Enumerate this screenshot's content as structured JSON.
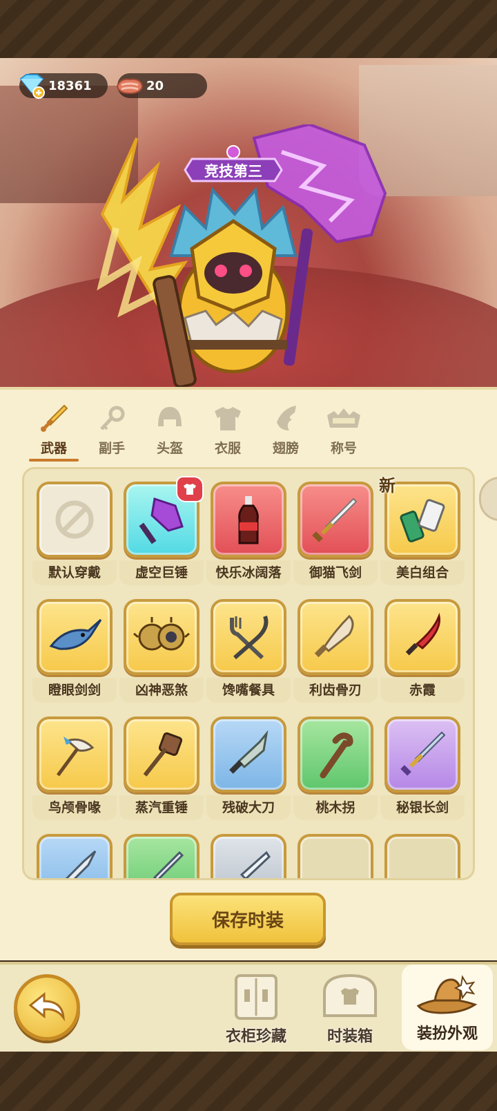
{
  "currency": {
    "gems": "18361",
    "meat": "20"
  },
  "character": {
    "title_banner": "竞技第三"
  },
  "tabs": [
    {
      "label": "武器",
      "icon": "sword-icon",
      "active": true
    },
    {
      "label": "副手",
      "icon": "key-icon",
      "active": false
    },
    {
      "label": "头盔",
      "icon": "helmet-icon",
      "active": false
    },
    {
      "label": "衣服",
      "icon": "armor-icon",
      "active": false
    },
    {
      "label": "翅膀",
      "icon": "wing-icon",
      "active": false
    },
    {
      "label": "称号",
      "icon": "title-icon",
      "active": false
    }
  ],
  "items": [
    {
      "name": "默认穿戴",
      "quality": "default",
      "icon": "none-icon"
    },
    {
      "name": "虚空巨锤",
      "quality": "cyan",
      "icon": "void-hammer-icon",
      "badge": "shirt"
    },
    {
      "name": "快乐冰阔落",
      "quality": "red",
      "icon": "cola-bottle-icon"
    },
    {
      "name": "御猫飞剑",
      "quality": "red",
      "icon": "flying-sword-icon"
    },
    {
      "name": "美白组合",
      "quality": "gold",
      "icon": "cosmetics-icon",
      "badge": "新"
    },
    {
      "name": "瞪眼剑剑",
      "quality": "gold",
      "icon": "swordfish-icon"
    },
    {
      "name": "凶神恶煞",
      "quality": "gold",
      "icon": "spiked-wheel-icon"
    },
    {
      "name": "馋嘴餐具",
      "quality": "gold",
      "icon": "fork-knife-icon"
    },
    {
      "name": "利齿骨刃",
      "quality": "gold",
      "icon": "bone-blade-icon"
    },
    {
      "name": "赤霞",
      "quality": "gold",
      "icon": "red-blade-icon"
    },
    {
      "name": "鸟颅骨喙",
      "quality": "gold",
      "icon": "skull-pick-icon"
    },
    {
      "name": "蒸汽重锤",
      "quality": "gold",
      "icon": "steam-hammer-icon"
    },
    {
      "name": "残破大刀",
      "quality": "blue",
      "icon": "broken-blade-icon"
    },
    {
      "name": "桃木拐",
      "quality": "green",
      "icon": "wooden-cane-icon"
    },
    {
      "name": "秘银长剑",
      "quality": "purple",
      "icon": "mithril-sword-icon"
    },
    {
      "name": "",
      "quality": "blue",
      "icon": "spear-icon"
    },
    {
      "name": "",
      "quality": "green",
      "icon": "dagger-icon"
    },
    {
      "name": "",
      "quality": "grey",
      "icon": "knife-icon"
    },
    {
      "name": "",
      "quality": "empty",
      "icon": ""
    },
    {
      "name": "",
      "quality": "empty",
      "icon": ""
    }
  ],
  "save_button": "保存时装",
  "bottom_nav": {
    "wardrobe": "衣柜珍藏",
    "fashion_box": "时装箱",
    "dress_up": "装扮外观"
  },
  "colors": {
    "panel_bg": "#f7efcf",
    "accent_gold": "#f0c23c",
    "tab_underline": "#c97a2b"
  }
}
